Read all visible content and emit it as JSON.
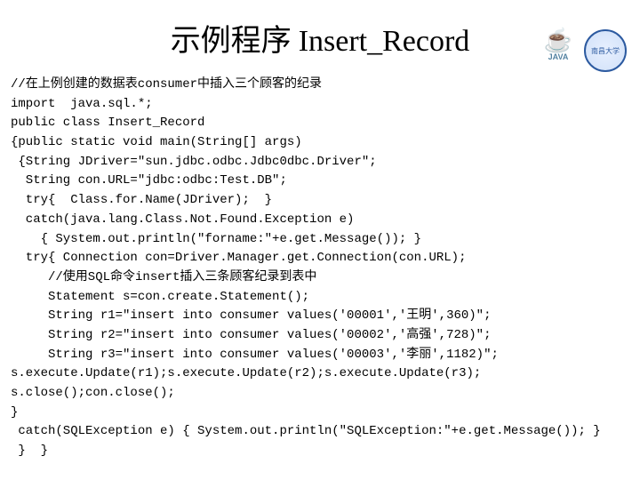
{
  "logos": {
    "java_cup": "☕",
    "java_label": "JAVA",
    "uni_label": "南昌大学"
  },
  "title": {
    "cn": "示例程序",
    "en": "Insert_Record"
  },
  "code": {
    "l01": "//在上例创建的数据表consumer中插入三个顾客的纪录",
    "l02": "import  java.sql.*;",
    "l03": "public class Insert_Record",
    "l04": "{public static void main(String[] args)",
    "l05": " {String JDriver=\"sun.jdbc.odbc.Jdbc0dbc.Driver\";",
    "l06": "  String con.URL=\"jdbc:odbc:Test.DB\";",
    "l07": "  try{  Class.for.Name(JDriver);  }",
    "l08": "  catch(java.lang.Class.Not.Found.Exception e)",
    "l09": "    { System.out.println(\"forname:\"+e.get.Message()); }",
    "l10": "  try{ Connection con=Driver.Manager.get.Connection(con.URL);",
    "l11": "     //使用SQL命令insert插入三条顾客纪录到表中",
    "l12": "     Statement s=con.create.Statement();",
    "l13": "     String r1=\"insert into consumer values('00001','王明',360)\";",
    "l14": "     String r2=\"insert into consumer values('00002','高强',728)\";",
    "l15": "     String r3=\"insert into consumer values('00003','李丽',1182)\";",
    "l16": "s.execute.Update(r1);s.execute.Update(r2);s.execute.Update(r3);",
    "l17": "s.close();con.close();",
    "l18": "}",
    "l19": " catch(SQLException e) { System.out.println(\"SQLException:\"+e.get.Message()); }",
    "l20": " }  }"
  }
}
